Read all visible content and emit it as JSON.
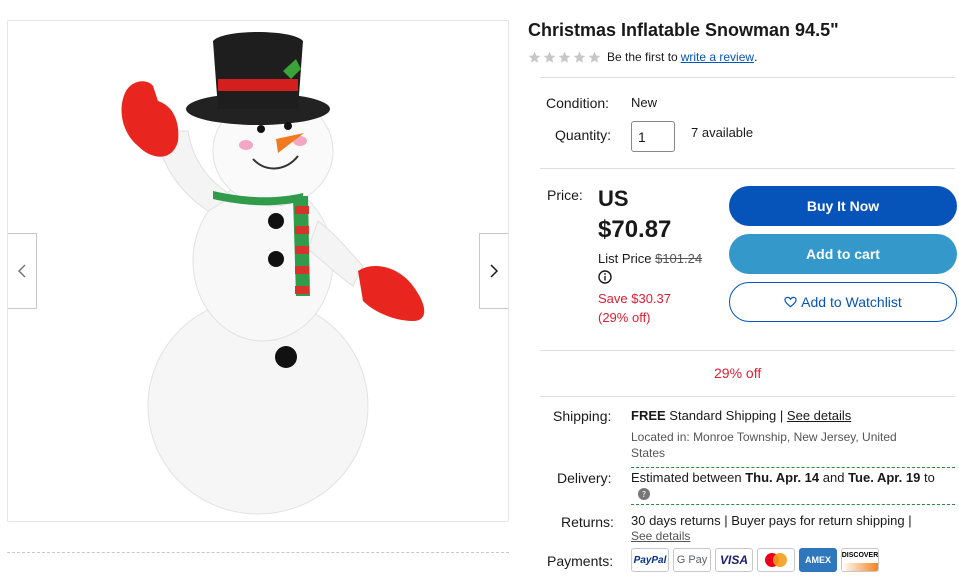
{
  "product": {
    "title": "Christmas Inflatable Snowman 94.5\"",
    "rating": {
      "stars_filled": 0,
      "stars_total": 5,
      "prompt_text": "Be the first to",
      "review_link": "write a review",
      "suffix": "."
    }
  },
  "details": {
    "condition_label": "Condition:",
    "condition_value": "New",
    "quantity_label": "Quantity:",
    "quantity_value": "1",
    "available_text": "7 available"
  },
  "pricing": {
    "price_label": "Price:",
    "currency_prefix": "US",
    "price": "$70.87",
    "list_price_label": "List Price",
    "list_price": "$101.24",
    "save_line1": "Save $30.37",
    "save_line2": "(29% off)",
    "discount_banner": "29% off"
  },
  "actions": {
    "buy_now": "Buy It Now",
    "add_to_cart": "Add to cart",
    "add_to_watchlist": "Add to Watchlist"
  },
  "shipping": {
    "label": "Shipping:",
    "free": "FREE",
    "method": "Standard Shipping",
    "separator": "|",
    "see_details": "See details",
    "located_in_label": "Located in:",
    "located_in": "Monroe Township, New Jersey, United States"
  },
  "delivery": {
    "label": "Delivery:",
    "estimated": "Estimated between",
    "date_start": "Thu. Apr. 14",
    "and": "and",
    "date_end": "Tue. Apr. 19",
    "to": "to"
  },
  "returns": {
    "label": "Returns:",
    "text": "30 days returns | Buyer pays for return shipping |",
    "see_details": "See details"
  },
  "payments": {
    "label": "Payments:",
    "methods": [
      "PayPal",
      "G Pay",
      "VISA",
      "Mastercard",
      "AMEX",
      "DISCOVER"
    ]
  },
  "colors": {
    "primary_blue": "#0654ba",
    "cart_blue": "#3498ca",
    "sale_red": "#dd1e31"
  },
  "icons": [
    "chevron-left-icon",
    "chevron-right-icon",
    "star-icon",
    "info-icon",
    "heart-icon",
    "question-icon"
  ]
}
